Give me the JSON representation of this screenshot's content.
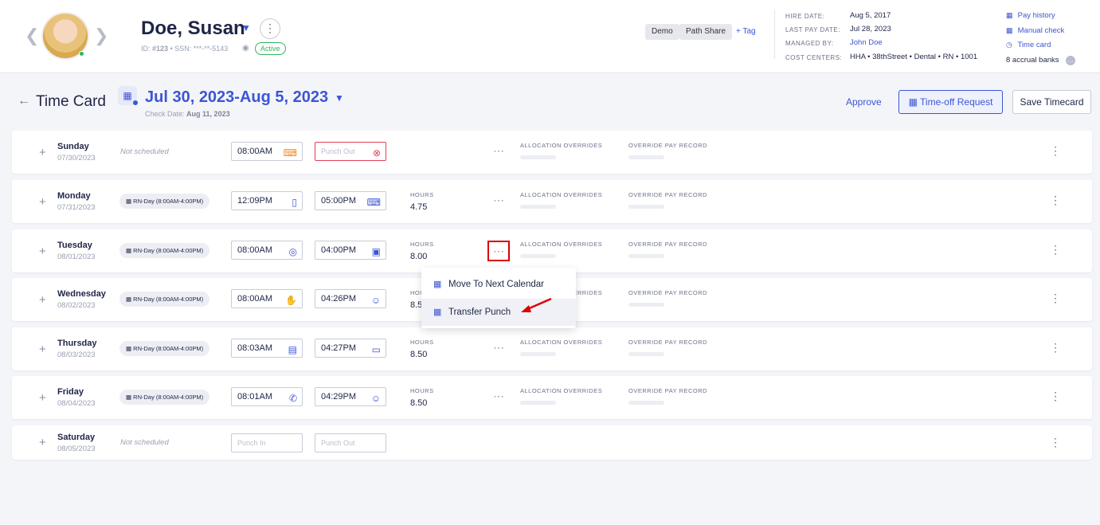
{
  "employee": {
    "name": "Doe, Susan",
    "id_label": "ID:",
    "id_value": "#123",
    "ssn": "• SSN: ***-**-5143",
    "status": "Active",
    "tags": [
      "Demo",
      "Path Share"
    ],
    "add_tag": "+ Tag"
  },
  "info": {
    "hire_date_label": "HIRE DATE:",
    "hire_date": "Aug 5, 2017",
    "last_pay_label": "LAST PAY DATE:",
    "last_pay": "Jul 28, 2023",
    "managed_label": "MANAGED BY:",
    "managed_by": "John Doe",
    "cost_label": "COST CENTERS:",
    "cost_centers": "HHA • 38thStreet • Dental • RN • 1001"
  },
  "side_links": {
    "pay_history": "Pay history",
    "manual_check": "Manual check",
    "time_card": "Time card",
    "accrual": "8 accrual banks"
  },
  "timecard": {
    "title": "Time Card",
    "date_range": "Jul 30, 2023-Aug 5, 2023",
    "check_label": "Check Date:",
    "check_date": "Aug 11, 2023",
    "approve": "Approve",
    "time_off": "Time-off Request",
    "save": "Save Timecard"
  },
  "columns": {
    "hours": "HOURS",
    "allocation": "ALLOCATION OVERRIDES",
    "override": "OVERRIDE PAY RECORD"
  },
  "days": [
    {
      "name": "Sunday",
      "date": "07/30/2023",
      "schedule": "Not scheduled",
      "in": "08:00AM",
      "in_icon": "keyboard-icon",
      "out": "Punch Out",
      "out_icon": "error-x-icon",
      "hours": ""
    },
    {
      "name": "Monday",
      "date": "07/31/2023",
      "schedule": "RN-Day (8:00AM-4:00PM)",
      "in": "12:09PM",
      "in_icon": "mobile-icon",
      "out": "05:00PM",
      "out_icon": "keyboard-icon",
      "hours": "4.75"
    },
    {
      "name": "Tuesday",
      "date": "08/01/2023",
      "schedule": "RN-Day (8:00AM-4:00PM)",
      "in": "08:00AM",
      "in_icon": "fingerprint-icon",
      "out": "04:00PM",
      "out_icon": "lock-icon",
      "hours": "8.00"
    },
    {
      "name": "Wednesday",
      "date": "08/02/2023",
      "schedule": "RN-Day (8:00AM-4:00PM)",
      "in": "08:00AM",
      "in_icon": "hand-icon",
      "out": "04:26PM",
      "out_icon": "face-scan-icon",
      "hours": "8.5"
    },
    {
      "name": "Thursday",
      "date": "08/03/2023",
      "schedule": "RN-Day (8:00AM-4:00PM)",
      "in": "08:03AM",
      "in_icon": "card-icon",
      "out": "04:27PM",
      "out_icon": "laptop-icon",
      "hours": "8.50"
    },
    {
      "name": "Friday",
      "date": "08/04/2023",
      "schedule": "RN-Day (8:00AM-4:00PM)",
      "in": "08:01AM",
      "in_icon": "phone-icon",
      "out": "04:29PM",
      "out_icon": "face-scan-icon",
      "hours": "8.50"
    },
    {
      "name": "Saturday",
      "date": "08/05/2023",
      "schedule": "Not scheduled",
      "in": "Punch In",
      "in_icon": "",
      "out": "Punch Out",
      "out_icon": "",
      "hours": ""
    }
  ],
  "menu": {
    "move_next": "Move To Next Calendar",
    "transfer": "Transfer Punch"
  },
  "colors": {
    "accent": "#3c55d6",
    "active_green": "#2db55d",
    "error_red": "#e0405a",
    "highlight_red": "#d90000"
  }
}
